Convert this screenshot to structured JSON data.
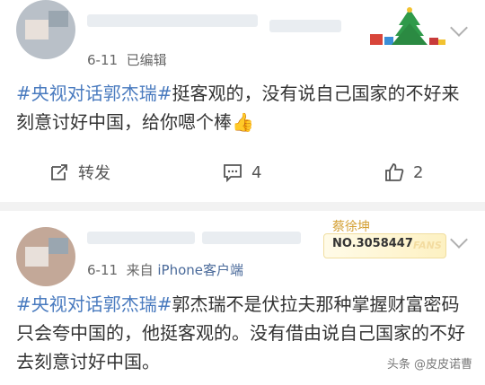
{
  "post1": {
    "meta_date": "6-11",
    "meta_status": "已编辑",
    "hashtag": "#央视对话郭杰瑞#",
    "text": "挺客观的，没有说自己国家的不好来刻意讨好中国，给你嗯个棒",
    "thumb_emoji": "👍",
    "repost_label": "转发",
    "comment_count": "4",
    "like_count": "2"
  },
  "post2": {
    "meta_date": "6-11",
    "meta_from": "来自",
    "meta_source": "iPhone客户端",
    "badge_name": "蔡徐坤",
    "badge_no": "NO.3058447",
    "badge_fans": "FANS",
    "hashtag": "#央视对话郭杰瑞#",
    "text": "郭杰瑞不是伏拉夫那种掌握财富密码只会夸中国的，他挺客观的。没有借由说自己国家的不好去刻意讨好中国。"
  },
  "watermark": "头条 @皮皮诺曹",
  "colors": {
    "link": "#4a7bbf",
    "badge_gold": "#d4a034"
  },
  "icons": [
    "repost-icon",
    "comment-icon",
    "like-icon",
    "chevron-down-icon",
    "christmas-tree-icon"
  ]
}
